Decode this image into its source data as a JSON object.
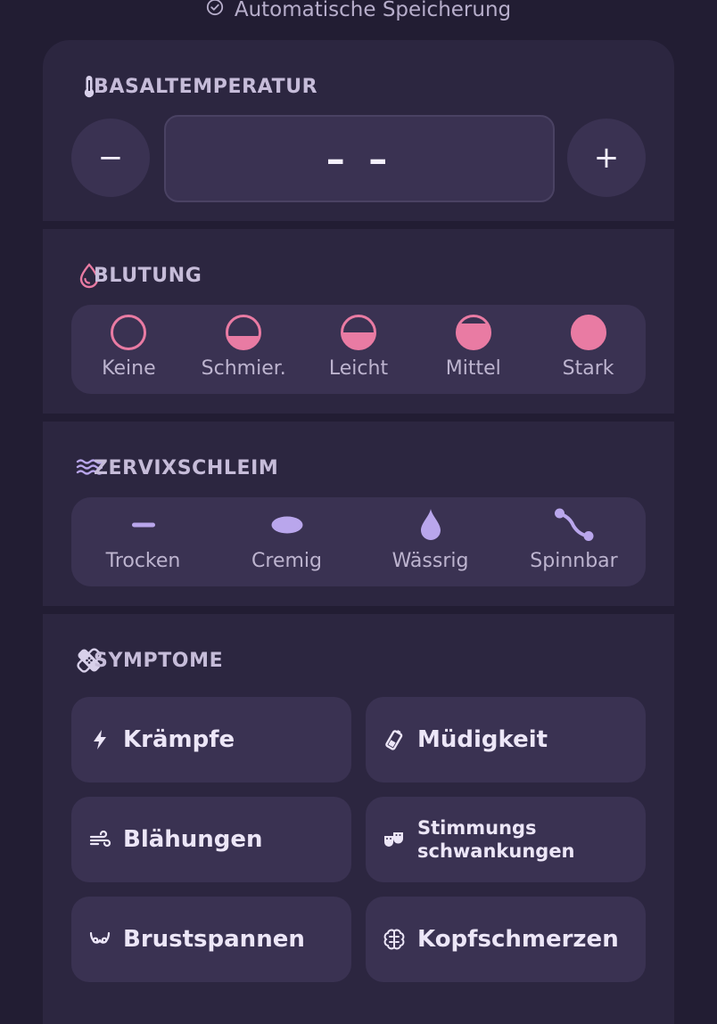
{
  "header": {
    "autosave_label": "Automatische Speicherung"
  },
  "temperature": {
    "title": "BASALTEMPERATUR",
    "minus_label": "−",
    "plus_label": "+",
    "value": "– –"
  },
  "bleeding": {
    "title": "BLUTUNG",
    "options": [
      {
        "label": "Keine",
        "level": 0
      },
      {
        "label": "Schmier.",
        "level": 0.25
      },
      {
        "label": "Leicht",
        "level": 0.5
      },
      {
        "label": "Mittel",
        "level": 0.75
      },
      {
        "label": "Stark",
        "level": 1
      }
    ]
  },
  "cervix": {
    "title": "ZERVIXSCHLEIM",
    "options": [
      {
        "label": "Trocken",
        "icon": "dash-icon"
      },
      {
        "label": "Cremig",
        "icon": "oval-icon"
      },
      {
        "label": "Wässrig",
        "icon": "drop-icon"
      },
      {
        "label": "Spinnbar",
        "icon": "stretch-icon"
      }
    ]
  },
  "symptoms": {
    "title": "SYMPTOME",
    "items": [
      {
        "label": "Krämpfe",
        "icon": "bolt-icon"
      },
      {
        "label": "Müdigkeit",
        "icon": "battery-low-icon"
      },
      {
        "label": "Blähungen",
        "icon": "wind-icon"
      },
      {
        "label": "Stimmungs schwankungen",
        "icon": "masks-icon"
      },
      {
        "label": "Brustspannen",
        "icon": "breast-icon"
      },
      {
        "label": "Kopfschmerzen",
        "icon": "brain-icon"
      }
    ]
  },
  "colors": {
    "background": "#221d33",
    "card": "#2c2640",
    "control": "#3a3252",
    "bleeding_accent": "#e97ba3",
    "cervix_accent": "#b9a6ec"
  }
}
